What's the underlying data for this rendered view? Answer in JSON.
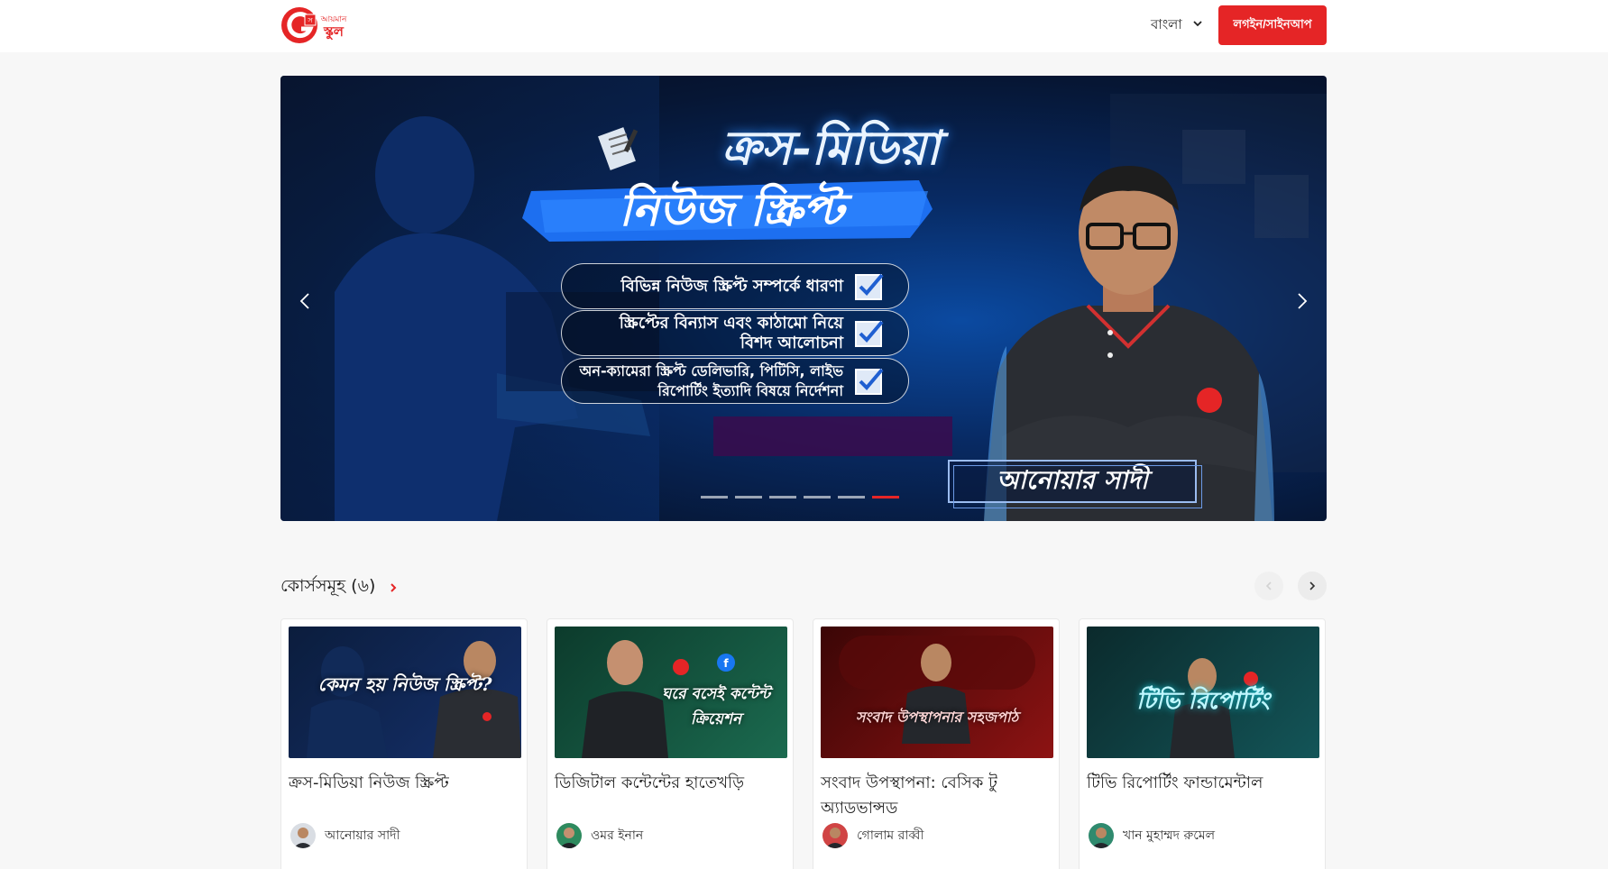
{
  "header": {
    "logo_alt": "আয়মান সাদিক স্কুল",
    "language": "বাংলা",
    "login_label": "লগইন/সাইনআপ"
  },
  "banner": {
    "title_line1": "ক্রস-মিডিয়া",
    "title_line2": "নিউজ স্ক্রিপ্ট",
    "points": [
      "বিভিন্ন নিউজ স্ক্রিপ্ট সম্পর্কে ধারণা",
      "স্ক্রিপ্টের বিন্যাস এবং কাঠামো নিয়ে বিশদ আলোচনা",
      "অন-ক্যামেরা স্ক্রিপ্ট ডেলিভারি, পিটিসি, লাইভ রিপোর্টিং ইত্যাদি বিষয়ে নির্দেশনা"
    ],
    "instructor_name": "আনোয়ার সাদী",
    "slide_count": 6,
    "active_slide": 6
  },
  "courses": {
    "section_label": "কোর্সসমূহ (৬)",
    "items": [
      {
        "title": "ক্রস-মিডিয়া নিউজ স্ক্রিপ্ট",
        "thumb_text": "কেমন হয় নিউজ স্ক্রিপ্ট?",
        "instructor": "আনোয়ার সাদী",
        "thumb_colors": [
          "#0b1d3d",
          "#15306b"
        ]
      },
      {
        "title": "ডিজিটাল কন্টেন্টের হাতেখড়ি",
        "thumb_text": "ঘরে বসেই কন্টেন্ট ক্রিয়েশন",
        "instructor": "ওমর ইনান",
        "thumb_colors": [
          "#0c3b2c",
          "#1b6a4f"
        ]
      },
      {
        "title": "সংবাদ উপস্থাপনা: বেসিক টু অ্যাডভান্সড",
        "thumb_text": "সংবাদ উপস্থাপনার সহজপাঠ",
        "instructor": "গোলাম রাব্বী",
        "thumb_colors": [
          "#3b0606",
          "#8d1313"
        ]
      },
      {
        "title": "টিভি রিপোর্টিং ফান্ডামেন্টাল",
        "thumb_text": "টিভি রিপোর্টিং",
        "instructor": "খান মুহাম্মদ রুমেল",
        "thumb_colors": [
          "#0b2a2c",
          "#135558"
        ]
      }
    ]
  },
  "colors": {
    "brand_red": "#e52526",
    "banner_blue": "#0b4aa1"
  }
}
